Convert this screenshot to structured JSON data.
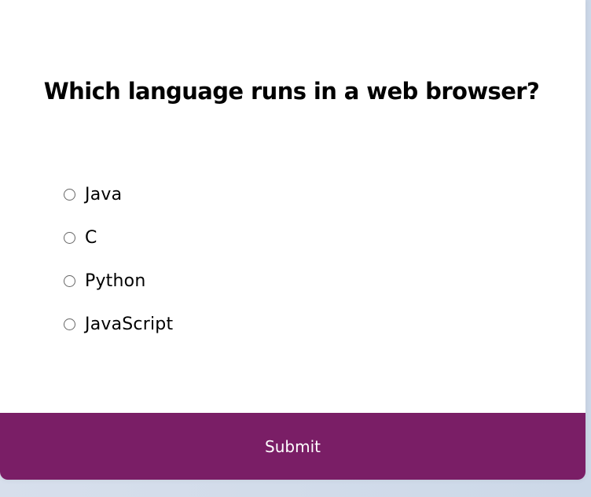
{
  "quiz": {
    "question": "Which language runs in a web browser?",
    "options": [
      {
        "label": "Java",
        "selected": false
      },
      {
        "label": "C",
        "selected": false
      },
      {
        "label": "Python",
        "selected": false
      },
      {
        "label": "JavaScript",
        "selected": false
      }
    ],
    "submit_label": "Submit"
  },
  "colors": {
    "submit_background": "#7a1e66",
    "page_background": "#d7dfec",
    "card_background": "#ffffff"
  }
}
